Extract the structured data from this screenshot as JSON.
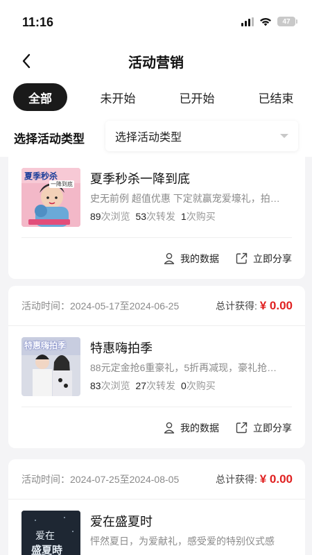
{
  "status_bar": {
    "time": "11:16",
    "battery": "47"
  },
  "header": {
    "title": "活动营销"
  },
  "tabs": [
    {
      "label": "全部",
      "active": true
    },
    {
      "label": "未开始",
      "active": false
    },
    {
      "label": "已开始",
      "active": false
    },
    {
      "label": "已结束",
      "active": false
    }
  ],
  "filter": {
    "label": "选择活动类型",
    "value": "选择活动类型"
  },
  "cards": [
    {
      "time_label": "",
      "time_range": "",
      "total_label": "",
      "total_amount": "",
      "title": "夏季秒杀一降到底",
      "desc": "史无前例 超值优惠 下定就赢宠爱壕礼，拍…",
      "views": "89",
      "views_label": "次浏览",
      "shares": "53",
      "shares_label": "次转发",
      "buys": "1",
      "buys_label": "次购买",
      "thumb_text": "夏季秒杀",
      "thumb_sub": "一降到底",
      "my_data": "我的数据",
      "share": "立即分享"
    },
    {
      "time_label": "活动时间：",
      "time_range": "2024-05-17至2024-06-25",
      "total_label": "总计获得: ",
      "total_amount": "¥ 0.00",
      "title": "特惠嗨拍季",
      "desc": "88元定金抢6重豪礼，5折再减现，豪礼抢…",
      "views": "83",
      "views_label": "次浏览",
      "shares": "27",
      "shares_label": "次转发",
      "buys": "0",
      "buys_label": "次购买",
      "thumb_text": "特惠嗨拍季",
      "thumb_sub": "",
      "my_data": "我的数据",
      "share": "立即分享"
    },
    {
      "time_label": "活动时间：",
      "time_range": "2024-07-25至2024-08-05",
      "total_label": "总计获得: ",
      "total_amount": "¥ 0.00",
      "title": "爱在盛夏时",
      "desc": "怦然夏日，为爱献礼，感受爱的特别仪式感",
      "thumb_text": "爱在",
      "thumb_sub": "盛夏時"
    }
  ]
}
